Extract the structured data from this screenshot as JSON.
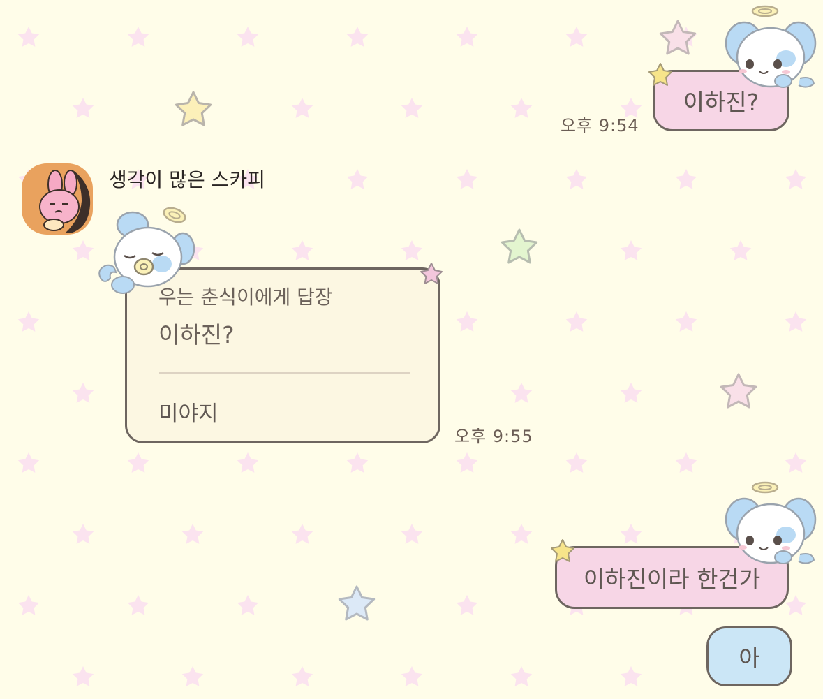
{
  "messages": [
    {
      "direction": "outgoing",
      "text": "이하진?",
      "time": "오후 9:54"
    },
    {
      "direction": "incoming",
      "sender": "생각이 많은 스카피",
      "reply_header": "우는 춘식이에게 답장",
      "quoted_text": "이하진?",
      "text": "미야지",
      "time": "오후 9:55"
    },
    {
      "direction": "outgoing",
      "text": "이하진이라 한건가"
    },
    {
      "direction": "outgoing",
      "text": "아"
    }
  ],
  "icons": {
    "sender_avatar": "pink-bunny-avatar-icon",
    "decorations": [
      "angel-puppy-icon",
      "angel-pup-sleeping-icon",
      "star-icon"
    ]
  },
  "colors": {
    "background": "#fffde9",
    "pattern_star": "#fbe3ef",
    "outgoing_bubble": "#f7d6e6",
    "short_bubble": "#cbe6f6",
    "incoming_bubble": "#fcf7e2",
    "avatar_bg": "#e9a25e"
  }
}
